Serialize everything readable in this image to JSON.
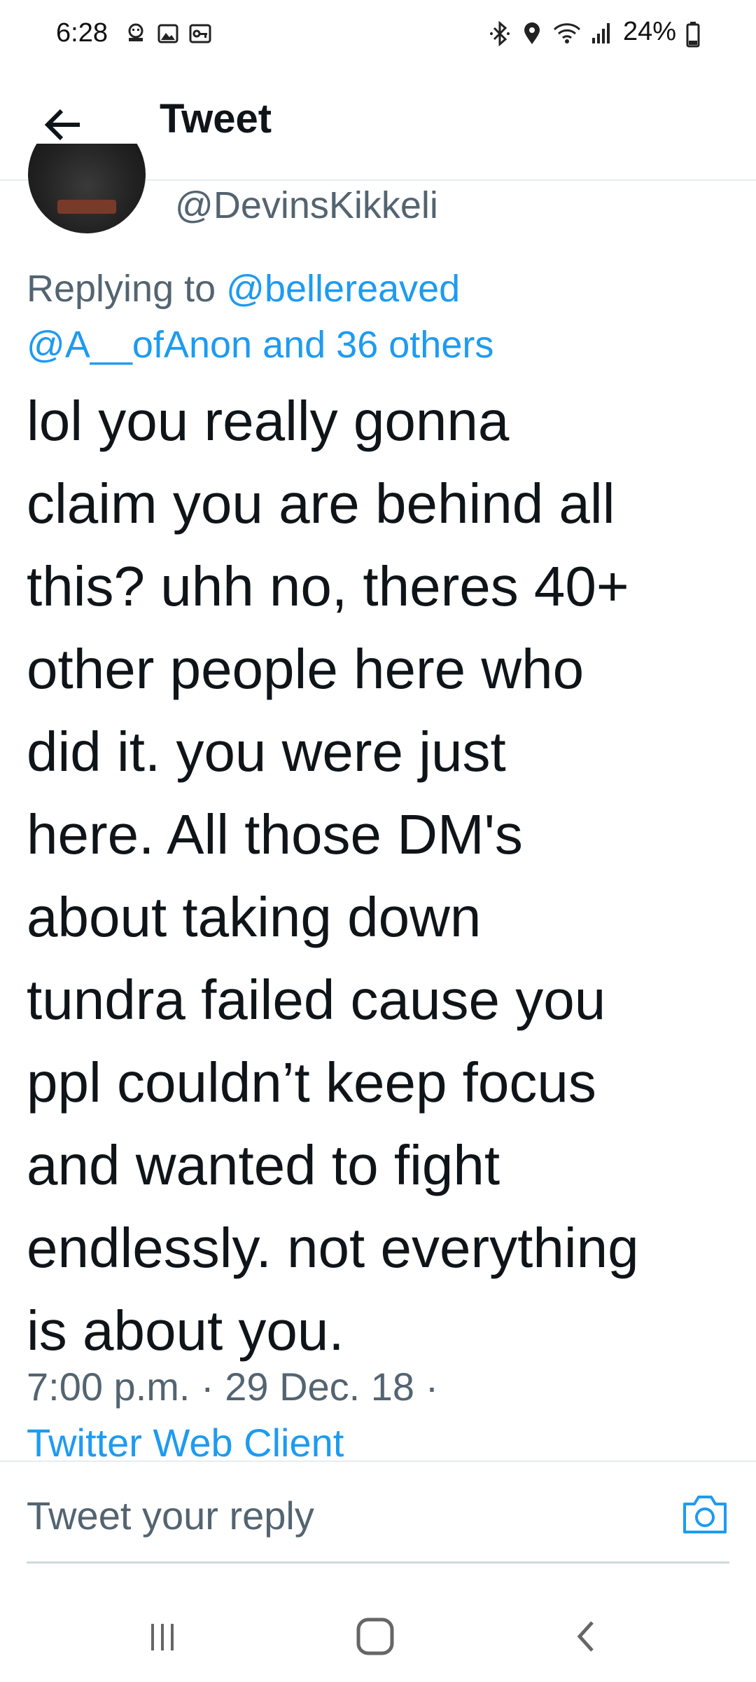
{
  "status_bar": {
    "time": "6:28",
    "battery": "24%",
    "left_icons": [
      "notification-icon",
      "gallery-icon",
      "vpn-key-icon"
    ],
    "right_icons": [
      "bluetooth-icon",
      "location-icon",
      "wifi-icon",
      "signal-icon",
      "battery-icon"
    ]
  },
  "header": {
    "title": "Tweet",
    "back_icon": "arrow-left-icon"
  },
  "tweet": {
    "handle": "@DevinsKikkeli",
    "replying_prefix": "Replying to ",
    "replying_user1": "@bellereaved",
    "replying_user2": "@A__ofAnon",
    "replying_others": "and 36 others",
    "text": "lol you really gonna\nclaim you are behind all\nthis? uhh no, theres 40+\nother people here who\ndid it. you were just\nhere. All those DM's\nabout taking down\ntundra failed cause you\nppl couldn’t keep focus\nand wanted to fight\nendlessly. not everything\nis about you.",
    "meta": "7:00 p.m. · 29 Dec. 18 ·",
    "source": "Twitter Web Client"
  },
  "reply": {
    "placeholder": "Tweet your reply",
    "camera_icon": "camera-icon"
  },
  "nav": {
    "icons": [
      "recent-apps-icon",
      "home-icon",
      "back-icon"
    ]
  },
  "colors": {
    "accent": "#1d9bf0",
    "secondary_text": "#536471",
    "primary_text": "#0f1419"
  }
}
